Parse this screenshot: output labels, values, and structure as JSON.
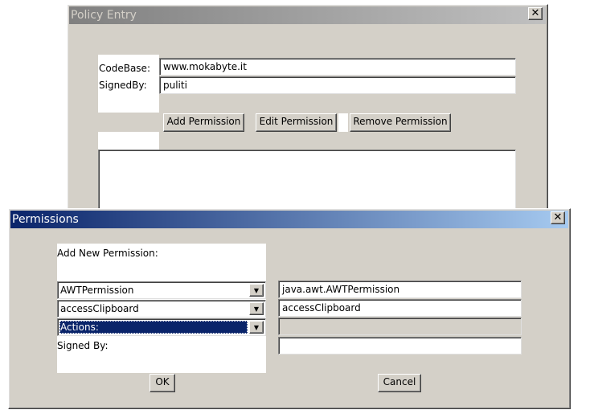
{
  "policy_window": {
    "title": "Policy Entry",
    "close_glyph": "✕",
    "codebase_label": "CodeBase:",
    "codebase_value": "www.mokabyte.it",
    "signedby_label": "SignedBy:",
    "signedby_value": "puliti",
    "add_permission_label": "Add Permission",
    "edit_permission_label": "Edit Permission",
    "remove_permission_label": "Remove Permission"
  },
  "permissions_dialog": {
    "title": "Permissions",
    "close_glyph": "✕",
    "heading": "Add New Permission:",
    "permission_combo": "AWTPermission",
    "permission_field": "java.awt.AWTPermission",
    "target_combo": "accessClipboard",
    "target_field": "accessClipboard",
    "actions_combo": "Actions:",
    "actions_field": "",
    "signed_by_label": "Signed By:",
    "signed_by_field": "",
    "ok_label": "OK",
    "cancel_label": "Cancel",
    "dropdown_glyph": "▼"
  },
  "colors": {
    "title_active_start": "#0a246a",
    "title_active_end": "#a6caf0",
    "title_inactive_start": "#808080",
    "title_inactive_end": "#c0c0c0",
    "face": "#d4d0c8"
  }
}
